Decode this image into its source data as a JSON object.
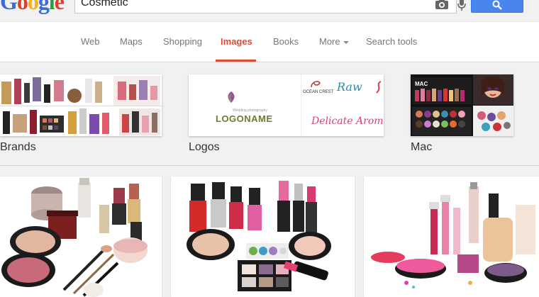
{
  "search": {
    "query": "Cosmetic"
  },
  "logo": {
    "letters": [
      "G",
      "o",
      "o",
      "g",
      "l",
      "e"
    ],
    "colors": [
      "#3b6bd9",
      "#d8402f",
      "#f3b21b",
      "#3b6bd9",
      "#2f9d3e",
      "#d8402f"
    ]
  },
  "tabs": [
    {
      "label": "Web",
      "active": false
    },
    {
      "label": "Maps",
      "active": false
    },
    {
      "label": "Shopping",
      "active": false
    },
    {
      "label": "Images",
      "active": true
    },
    {
      "label": "Books",
      "active": false
    },
    {
      "label": "More",
      "active": false
    },
    {
      "label": "Search tools",
      "active": false
    }
  ],
  "related": [
    {
      "label": "Brands"
    },
    {
      "label": "Logos"
    },
    {
      "label": "Mac"
    }
  ],
  "logos_thumb": {
    "main": "LOGONAME",
    "main_sub": "Wedding photography",
    "logo_a": "OCEAN CREST",
    "logo_b": "Raw",
    "logo_c": "Delicate Aroma"
  },
  "colors": {
    "accent": "#dd4b39",
    "search_button": "#4885ed"
  }
}
